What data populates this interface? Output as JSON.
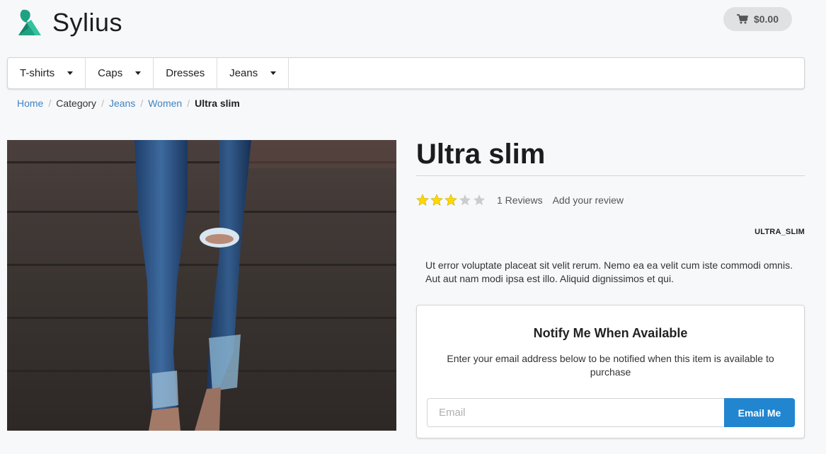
{
  "header": {
    "logo_text": "Sylius",
    "brand_color": "#20a182",
    "cart_total": "$0.00"
  },
  "nav": {
    "items": [
      {
        "label": "T-shirts",
        "has_dropdown": true
      },
      {
        "label": "Caps",
        "has_dropdown": true
      },
      {
        "label": "Dresses",
        "has_dropdown": false
      },
      {
        "label": "Jeans",
        "has_dropdown": true
      }
    ]
  },
  "breadcrumb": {
    "home": "Home",
    "category": "Category",
    "jeans": "Jeans",
    "women": "Women",
    "current": "Ultra slim"
  },
  "product": {
    "title": "Ultra slim",
    "rating": 3,
    "rating_max": 5,
    "reviews_count": "1 Reviews",
    "add_review": "Add your review",
    "sku": "ULTRA_SLIM",
    "description": "Ut error voluptate placeat sit velit rerum. Nemo ea ea velit cum iste commodi omnis. Aut aut nam modi ipsa est illo. Aliquid dignissimos et qui."
  },
  "notify": {
    "title": "Notify Me When Available",
    "text": "Enter your email address below to be notified when this item is available to purchase",
    "email_placeholder": "Email",
    "email_value": "",
    "button_label": "Email Me"
  },
  "colors": {
    "link": "#4183c4",
    "primary_button": "#2185d0",
    "star_filled": "#ffd800",
    "star_empty": "#cccccc"
  }
}
